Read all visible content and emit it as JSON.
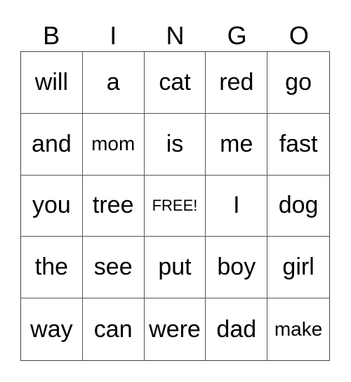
{
  "header": [
    "B",
    "I",
    "N",
    "G",
    "O"
  ],
  "rows": [
    [
      "will",
      "a",
      "cat",
      "red",
      "go"
    ],
    [
      "and",
      "mom",
      "is",
      "me",
      "fast"
    ],
    [
      "you",
      "tree",
      "FREE!",
      "I",
      "dog"
    ],
    [
      "the",
      "see",
      "put",
      "boy",
      "girl"
    ],
    [
      "way",
      "can",
      "were",
      "dad",
      "make"
    ]
  ]
}
